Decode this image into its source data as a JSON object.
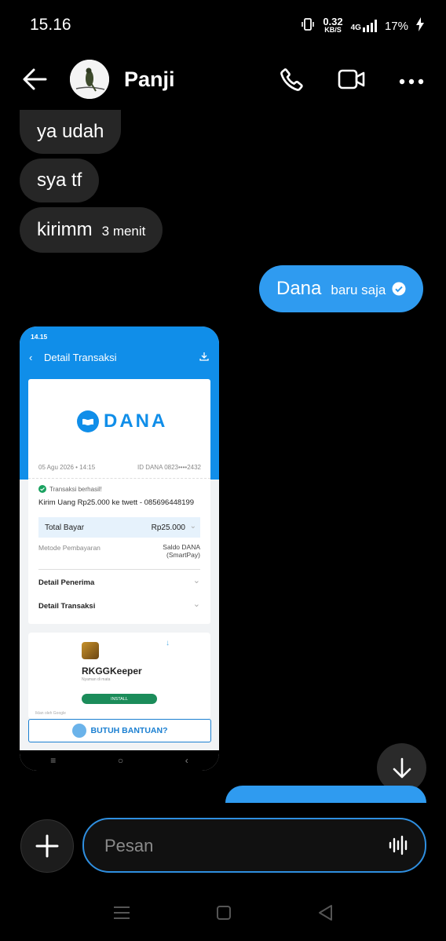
{
  "status_bar": {
    "time": "15.16",
    "net_speed": "0.32",
    "net_unit": "KB/S",
    "network": "4G",
    "battery": "17%"
  },
  "header": {
    "contact_name": "Panji"
  },
  "messages": [
    {
      "text": "ya udah",
      "direction": "in"
    },
    {
      "text": "sya tf",
      "direction": "in"
    },
    {
      "text": "kirimm",
      "time": "3 menit",
      "direction": "in"
    },
    {
      "text": "Dana",
      "time": "baru saja",
      "direction": "out",
      "status": "read"
    }
  ],
  "attachment": {
    "status_time": "14.15",
    "title": "Detail Transaksi",
    "brand": "DANA",
    "date": "05 Agu 2026 • 14:15",
    "dana_id": "ID DANA  0823••••2432",
    "status": "Transaksi berhasil!",
    "description": "Kirim Uang Rp25.000 ke twett - 085696448199",
    "total_label": "Total Bayar",
    "total_value": "Rp25.000",
    "method_label": "Metode Pembayaran",
    "method_value_1": "Saldo DANA",
    "method_value_2": "(SmartPay)",
    "recipient_label": "Detail Penerima",
    "transaction_label": "Detail Transaksi",
    "ad_app_name": "RKGGKeeper",
    "ad_tagline": "Nyaman di mata",
    "ad_install": "INSTALL",
    "ad_footer": "Iklan oleh Google",
    "help_label": "BUTUH BANTUAN?"
  },
  "composer": {
    "placeholder": "Pesan"
  },
  "colors": {
    "outgoing": "#2f9bf0",
    "incoming": "#262626",
    "accent": "#2f8fe0",
    "dana_blue": "#108ee9"
  }
}
